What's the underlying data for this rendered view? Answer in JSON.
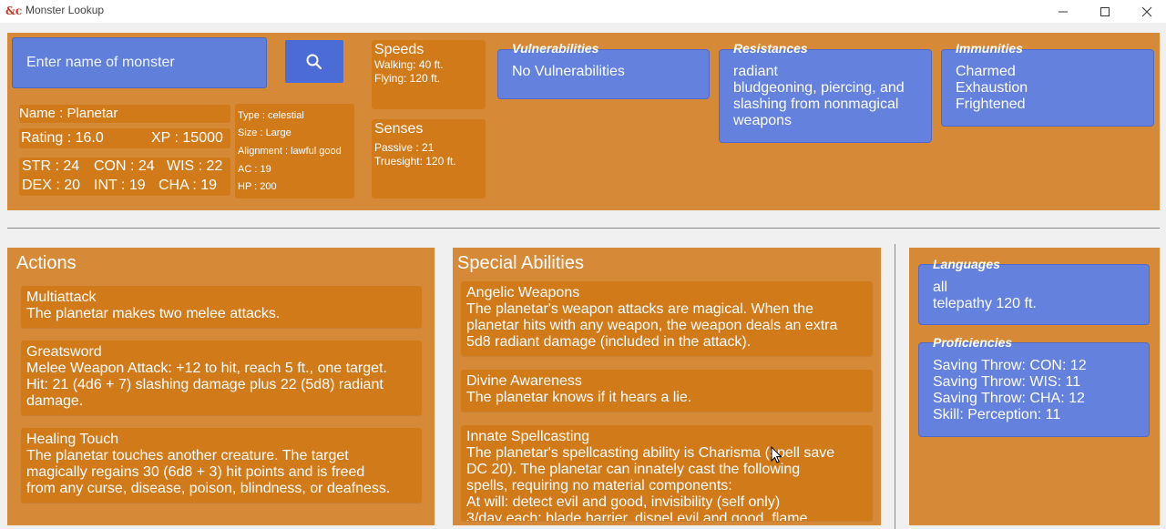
{
  "window": {
    "title": "Monster Lookup",
    "icon_text": "&c",
    "minimize_glyph": "—",
    "maximize_glyph": "☐",
    "close_glyph": "✕"
  },
  "search": {
    "placeholder": "Enter name of monster",
    "value": "",
    "icon": "search-icon"
  },
  "monster": {
    "name": "Name : Planetar",
    "rating": "Rating : 16.0",
    "xp": "XP : 15000",
    "str": "STR : 24",
    "con": "CON : 24",
    "wis": "WIS : 22",
    "dex": "DEX : 20",
    "int": "INT : 19",
    "cha": "CHA : 19",
    "type": "Type : celestial",
    "size": "Size : Large",
    "alignment": "Alignment : lawful good",
    "ac": "AC : 19",
    "hp": "HP : 200"
  },
  "speeds": {
    "title": "Speeds",
    "lines": [
      "Walking: 40 ft.",
      "Flying: 120 ft."
    ]
  },
  "senses": {
    "title": "Senses",
    "lines": [
      "Passive : 21",
      "Truesight: 120 ft."
    ]
  },
  "vulnerabilities": {
    "title": "Vulnerabilities",
    "lines": [
      "No Vulnerabilities"
    ]
  },
  "resistances": {
    "title": "Resistances",
    "lines": [
      "radiant",
      "bludgeoning, piercing, and",
      "slashing from nonmagical",
      "weapons"
    ]
  },
  "immunities": {
    "title": "Immunities",
    "lines": [
      "Charmed",
      "Exhaustion",
      "Frightened"
    ]
  },
  "actions": {
    "title": "Actions",
    "items": [
      {
        "name": "Multiattack",
        "lines": [
          "The planetar makes two melee attacks."
        ]
      },
      {
        "name": "Greatsword",
        "lines": [
          "Melee Weapon Attack: +12 to hit, reach 5 ft., one target.",
          "Hit: 21 (4d6 + 7) slashing damage plus 22 (5d8) radiant",
          "damage."
        ]
      },
      {
        "name": "Healing Touch",
        "lines": [
          "The planetar touches another creature. The target",
          "magically regains 30 (6d8 + 3) hit points and is freed",
          "from any curse, disease, poison, blindness, or deafness."
        ]
      }
    ]
  },
  "special_abilities": {
    "title": "Special Abilities",
    "items": [
      {
        "name": "Angelic Weapons",
        "lines": [
          "The planetar's weapon attacks are magical. When the",
          "planetar hits with any weapon, the weapon deals an extra",
          "5d8 radiant damage (included in the attack)."
        ]
      },
      {
        "name": "Divine Awareness",
        "lines": [
          "The planetar knows if it hears a lie."
        ]
      },
      {
        "name": "Innate Spellcasting",
        "lines": [
          "The planetar's spellcasting ability is Charisma (spell save",
          "DC 20). The planetar can innately cast the following",
          "spells, requiring no material components:",
          "At will: detect evil and good, invisibility (self only)",
          "3/day each: blade barrier, dispel evil and good, flame"
        ]
      }
    ]
  },
  "languages": {
    "title": "Languages",
    "lines": [
      "all",
      "telepathy 120 ft."
    ]
  },
  "proficiencies": {
    "title": "Proficiencies",
    "lines": [
      "Saving Throw: CON: 12",
      "Saving Throw: WIS: 11",
      "Saving Throw: CHA: 12",
      "Skill: Perception: 11"
    ]
  },
  "colors": {
    "panel": "#d68a38",
    "card": "#d17a1a",
    "blue": "#6381dd",
    "search_button": "#4b6bd6"
  }
}
